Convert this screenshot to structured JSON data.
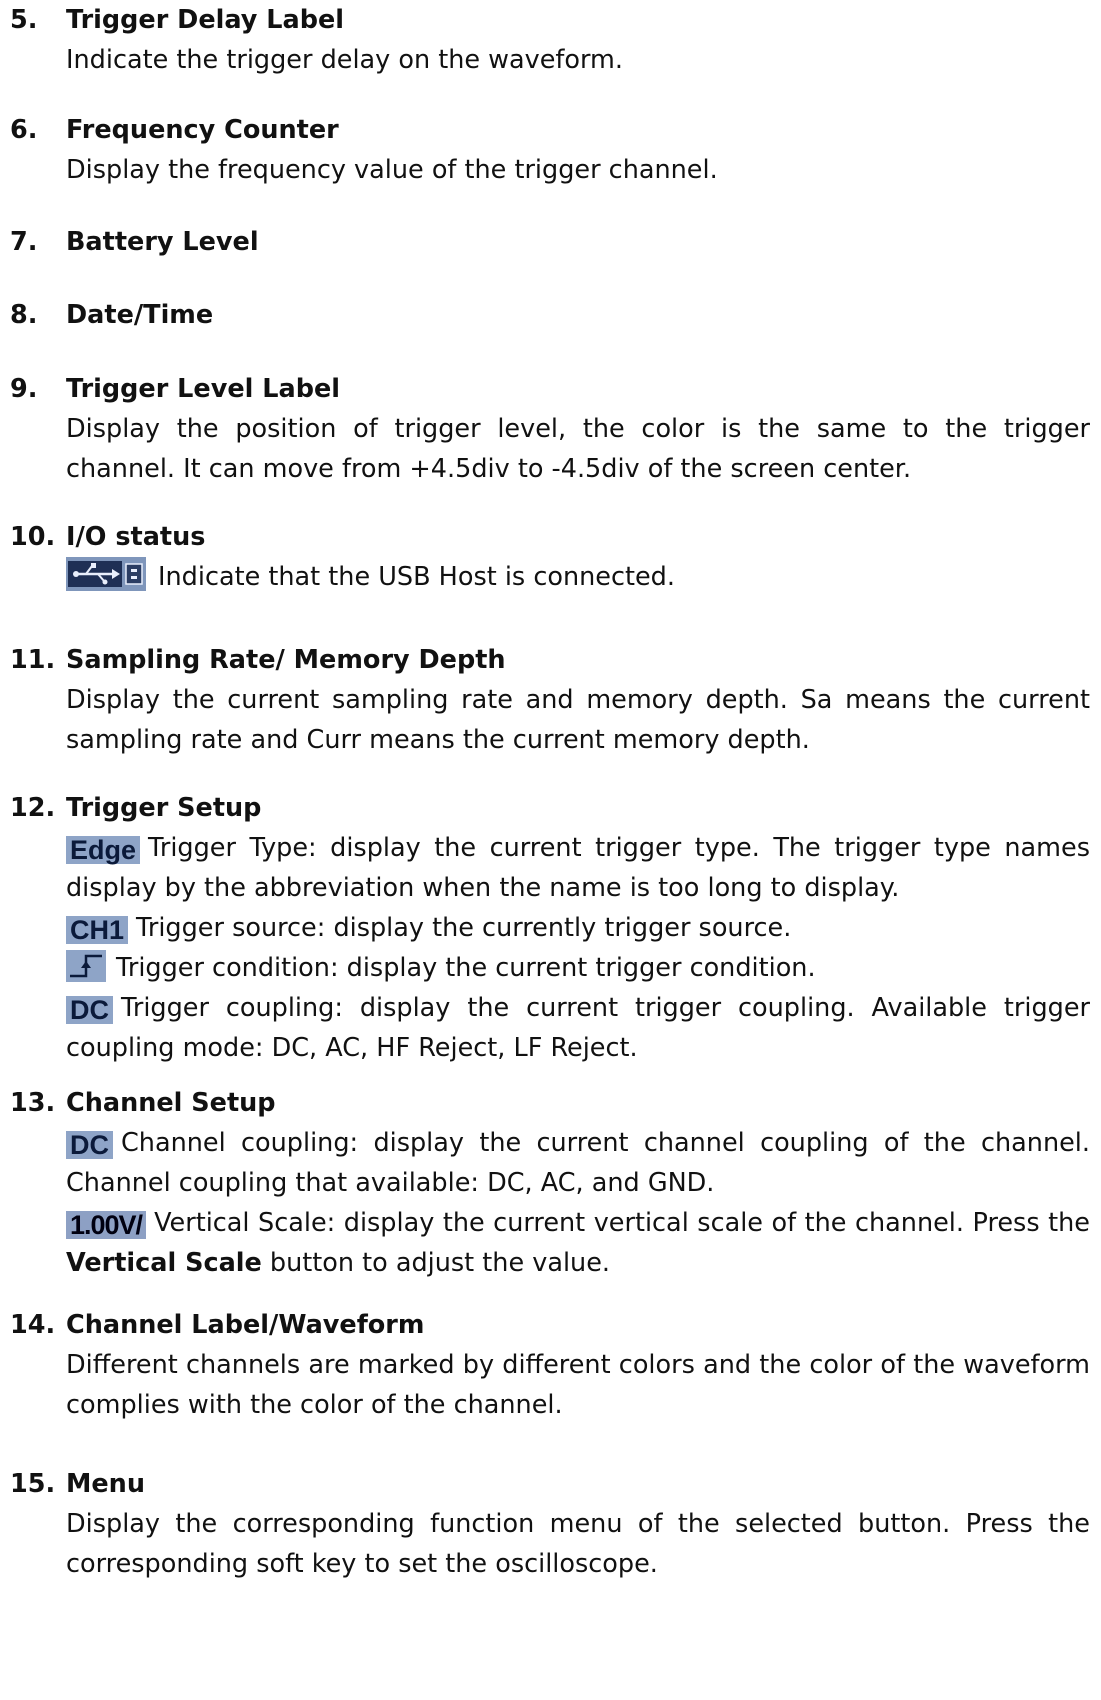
{
  "items": [
    {
      "num": "5.",
      "title": "Trigger Delay Label",
      "body": "Indicate the trigger delay on the waveform."
    },
    {
      "num": "6.",
      "title": "Frequency Counter",
      "body": "Display the frequency value of the trigger channel."
    },
    {
      "num": "7.",
      "title": "Battery Level"
    },
    {
      "num": "8.",
      "title": "Date/Time"
    },
    {
      "num": "9.",
      "title": "Trigger Level Label",
      "body": "Display the position of trigger level, the color is the same to the trigger channel. It can move from +4.5div to -4.5div of the screen center."
    },
    {
      "num": "10.",
      "title": "I/O status",
      "body": "Indicate that the USB Host is connected.",
      "icon": "usb-host-icon"
    },
    {
      "num": "11.",
      "title": "Sampling Rate/ Memory Depth",
      "body": "Display the current sampling rate and memory depth. Sa means the current sampling rate and Curr means the current memory depth."
    },
    {
      "num": "12.",
      "title": "Trigger Setup",
      "lines": [
        {
          "badge": "Edge",
          "text": "Trigger Type: display the current trigger type. The trigger type names display by the abbreviation when the name is too long to display."
        },
        {
          "badge": "CH1",
          "text": "Trigger source: display the currently trigger source."
        },
        {
          "icon": "rising-edge-icon",
          "text": "Trigger condition: display the current trigger condition."
        },
        {
          "badge": "DC",
          "text": "Trigger coupling: display the current trigger coupling. Available trigger coupling mode: DC, AC, HF Reject, LF Reject."
        }
      ]
    },
    {
      "num": "13.",
      "title": "Channel Setup",
      "lines": [
        {
          "badge": "DC",
          "text": "Channel coupling: display the current channel coupling of the channel. Channel coupling that available: DC, AC, and GND."
        },
        {
          "badge": "1.00V/",
          "text_pre": "Vertical Scale: display the current vertical scale of the channel. Press the",
          "bold": "Vertical Scale",
          "text_post": "button to adjust the value."
        }
      ]
    },
    {
      "num": "14.",
      "title": "Channel Label/Waveform",
      "body": "Different channels are marked by different colors and the color of the waveform complies with the color of the channel."
    },
    {
      "num": "15.",
      "title": "Menu",
      "body": "Display the corresponding function menu of the selected button. Press the corresponding soft key to set the oscilloscope."
    }
  ],
  "colors": {
    "badge_bg": "#8ea4c7",
    "badge_text": "#0b1a3a",
    "text": "#111111"
  }
}
